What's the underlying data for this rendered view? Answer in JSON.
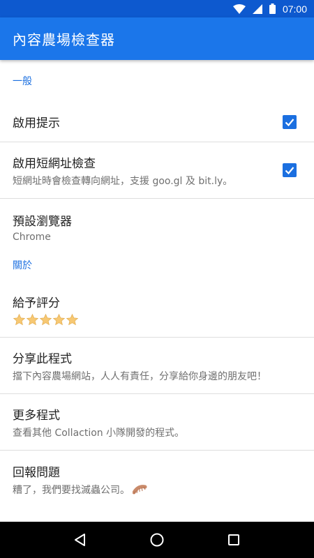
{
  "status_bar": {
    "time": "07:00",
    "icons": [
      "wifi-icon",
      "signal-icon",
      "battery-icon"
    ]
  },
  "app_bar": {
    "title": "內容農場檢查器"
  },
  "sections": {
    "general": {
      "header": "一般",
      "items": {
        "enable_hints": {
          "title": "啟用提示",
          "checked": true
        },
        "enable_short_url": {
          "title": "啟用短網址檢查",
          "summary": "短網址時會檢查轉向網址，支援 goo.gl 及 bit.ly。",
          "checked": true
        },
        "default_browser": {
          "title": "預設瀏覽器",
          "summary": "Chrome"
        }
      }
    },
    "about": {
      "header": "關於",
      "items": {
        "rate": {
          "title": "給予評分",
          "stars": 5
        },
        "share": {
          "title": "分享此程式",
          "summary": "擋下內容農場網站，人人有責任，分享給你身邊的朋友吧！"
        },
        "more_apps": {
          "title": "更多程式",
          "summary": "查看其他 Collaction 小隊開發的程式。"
        },
        "report": {
          "title": "回報問題",
          "summary": "糟了，我們要找滅蟲公司。"
        }
      }
    }
  },
  "colors": {
    "status_bar": "#0d59cf",
    "app_bar": "#1b76ea",
    "accent": "#1b6fe0",
    "star": "#f7c873"
  },
  "nav_bar": {
    "icons": [
      "back-icon",
      "home-icon",
      "recents-icon"
    ]
  }
}
